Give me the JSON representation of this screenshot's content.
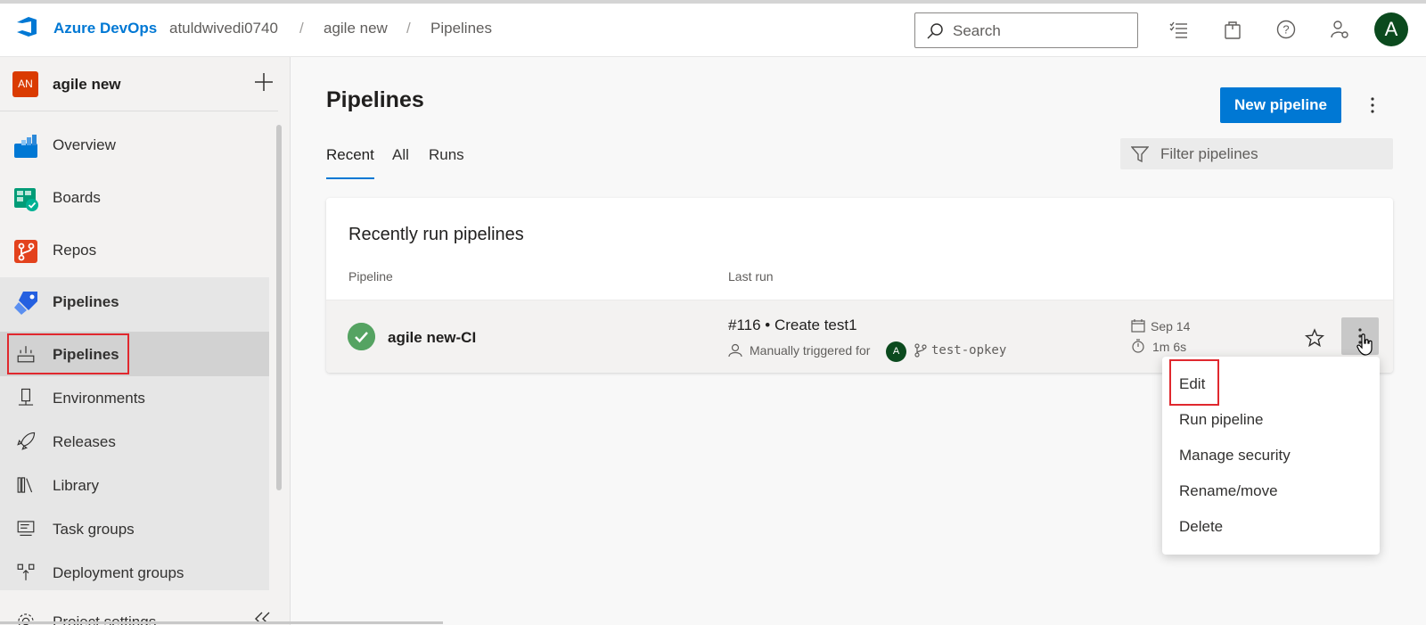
{
  "header": {
    "brand": "Azure DevOps",
    "breadcrumbs": [
      "atuldwivedi0740",
      "agile new",
      "Pipelines"
    ],
    "search_placeholder": "Search",
    "user_initial": "A"
  },
  "sidebar": {
    "project_badge": "AN",
    "project_name": "agile new",
    "items": [
      {
        "label": "Overview",
        "icon": "overview-icon"
      },
      {
        "label": "Boards",
        "icon": "boards-icon"
      },
      {
        "label": "Repos",
        "icon": "repos-icon"
      },
      {
        "label": "Pipelines",
        "icon": "pipelines-icon"
      }
    ],
    "sub_items": [
      {
        "label": "Pipelines",
        "icon": "pipelines-sub-icon"
      },
      {
        "label": "Environments",
        "icon": "environments-icon"
      },
      {
        "label": "Releases",
        "icon": "releases-icon"
      },
      {
        "label": "Library",
        "icon": "library-icon"
      },
      {
        "label": "Task groups",
        "icon": "task-groups-icon"
      },
      {
        "label": "Deployment groups",
        "icon": "deployment-groups-icon"
      }
    ],
    "settings_label": "Project settings"
  },
  "main": {
    "title": "Pipelines",
    "new_button": "New pipeline",
    "tabs": [
      "Recent",
      "All",
      "Runs"
    ],
    "active_tab": "Recent",
    "filter_placeholder": "Filter pipelines",
    "card": {
      "title": "Recently run pipelines",
      "columns": [
        "Pipeline",
        "Last run"
      ],
      "row": {
        "name": "agile new-CI",
        "run_title": "#116 • Create test1",
        "trigger_text": "Manually triggered for",
        "trigger_user_initial": "A",
        "branch": "test-opkey",
        "date": "Sep 14",
        "duration": "1m 6s",
        "status": "succeeded"
      }
    }
  },
  "context_menu": {
    "items": [
      "Edit",
      "Run pipeline",
      "Manage security",
      "Rename/move",
      "Delete"
    ]
  },
  "colors": {
    "accent": "#0078d4",
    "success": "#55a362",
    "highlight": "#e0282e",
    "project_badge": "#da3b01",
    "avatar": "#0b4a1e"
  }
}
